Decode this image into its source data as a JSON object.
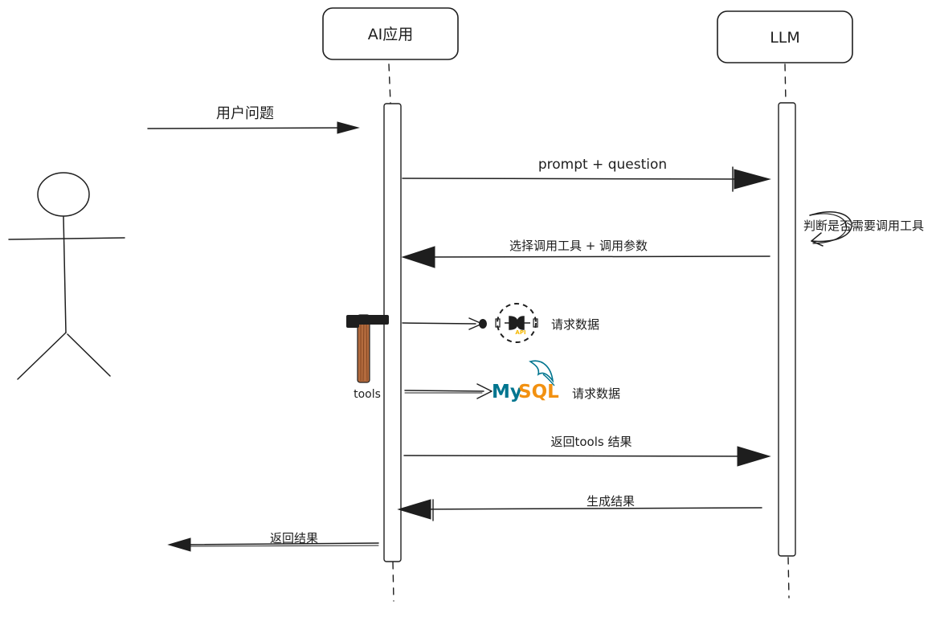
{
  "participants": {
    "ai_app": "AI应用",
    "llm": "LLM"
  },
  "messages": {
    "user_question": "用户问题",
    "prompt_question": "prompt + question",
    "llm_decide": "判断是否需要调用工具",
    "select_tool": "选择调用工具 + 调用参数",
    "request_api": "请求数据",
    "request_mysql": "请求数据",
    "return_tools": "返回tools 结果",
    "generate_result": "生成结果",
    "return_result": "返回结果"
  },
  "tools": {
    "label": "tools",
    "api_badge": "API",
    "mysql_logo_my": "My",
    "mysql_logo_sql": "SQL"
  },
  "colors": {
    "ink": "#1e1e1e",
    "hammer_handle": "#b36b3e",
    "mysql_blue": "#00758f",
    "mysql_orange": "#f29111",
    "api_yellow": "#f5b800"
  }
}
